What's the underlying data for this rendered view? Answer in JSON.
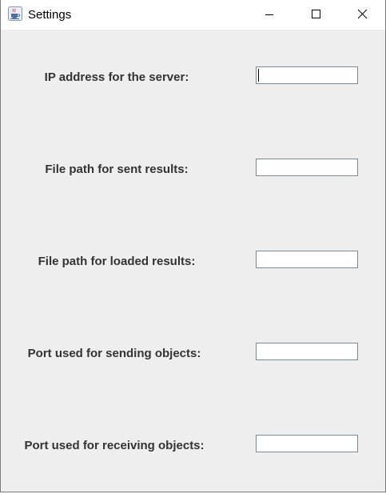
{
  "window": {
    "title": "Settings",
    "app_icon": "java-cup-icon",
    "controls": {
      "minimize_icon": "minimize-icon",
      "maximize_icon": "maximize-icon",
      "close_icon": "close-icon"
    }
  },
  "form": {
    "fields": [
      {
        "label": "IP address for the server:",
        "value": "",
        "focused": true
      },
      {
        "label": "File path for sent results:",
        "value": ""
      },
      {
        "label": "File path for loaded results:",
        "value": ""
      },
      {
        "label": "Port used for sending objects:",
        "value": ""
      },
      {
        "label": "Port used for receiving objects:",
        "value": ""
      }
    ]
  },
  "colors": {
    "background": "#eeeeee",
    "label_text": "#333333",
    "field_border": "#7a8a99"
  }
}
